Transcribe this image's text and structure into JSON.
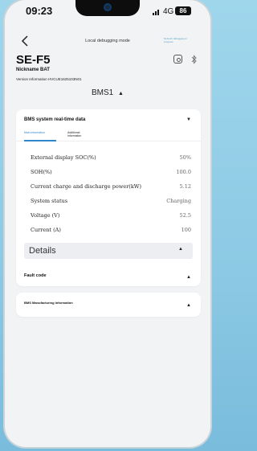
{
  "status": {
    "time": "09:23",
    "network": "4G",
    "battery": "86"
  },
  "header": {
    "back_icon": "chevron-left-icon",
    "mode": "Local debugging mode",
    "top_link": "Network debugging in progress"
  },
  "device": {
    "model": "SE-F5",
    "nickname": "Nickname BAT",
    "version": "Version Information HVCUE1625103N01"
  },
  "bms_selector": {
    "value": "BMS1",
    "caret": "▲"
  },
  "realtime": {
    "title": "BMS system real-time data",
    "caret": "▼",
    "tabs": [
      "Main information",
      "Additional information"
    ],
    "rows": [
      {
        "label": "External display SOC(%)",
        "value": "50%"
      },
      {
        "label": "SOH(%)",
        "value": "100.0"
      },
      {
        "label": "Current charge and discharge power(kW)",
        "value": "5.12"
      },
      {
        "label": "System status",
        "value": "Charging"
      },
      {
        "label": "Voltage (V)",
        "value": "52.5"
      },
      {
        "label": "Current (A)",
        "value": "100"
      }
    ],
    "details_label": "Details",
    "details_caret": "▲"
  },
  "fault": {
    "title": "Fault code",
    "caret": "▲"
  },
  "manufacturing": {
    "title": "BMS Manufacturing Information",
    "caret": "▲"
  }
}
